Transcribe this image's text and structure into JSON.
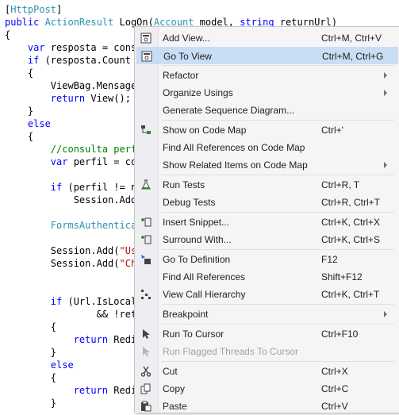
{
  "code_lines": [
    [
      {
        "t": "[",
        "c": "plain"
      },
      {
        "t": "HttpPost",
        "c": "type"
      },
      {
        "t": "]",
        "c": "plain"
      }
    ],
    [
      {
        "t": "public ",
        "c": "kw"
      },
      {
        "t": "ActionResult",
        "c": "type"
      },
      {
        "t": " LogOn(",
        "c": "plain"
      },
      {
        "t": "Account",
        "c": "type"
      },
      {
        "t": " model, ",
        "c": "plain"
      },
      {
        "t": "string",
        "c": "kw"
      },
      {
        "t": " returnUrl)",
        "c": "plain"
      }
    ],
    [
      {
        "t": "{",
        "c": "plain"
      }
    ],
    [
      {
        "t": "    ",
        "c": "plain"
      },
      {
        "t": "var",
        "c": "kw"
      },
      {
        "t": " resposta = cons",
        "c": "plain"
      }
    ],
    [
      {
        "t": "    ",
        "c": "plain"
      },
      {
        "t": "if",
        "c": "kw"
      },
      {
        "t": " (resposta.Count",
        "c": "plain"
      }
    ],
    [
      {
        "t": "    {",
        "c": "plain"
      }
    ],
    [
      {
        "t": "        ViewBag.Mensage",
        "c": "plain"
      }
    ],
    [
      {
        "t": "        ",
        "c": "plain"
      },
      {
        "t": "return",
        "c": "kw"
      },
      {
        "t": " View();",
        "c": "plain"
      }
    ],
    [
      {
        "t": "    }",
        "c": "plain"
      }
    ],
    [
      {
        "t": "    ",
        "c": "plain"
      },
      {
        "t": "else",
        "c": "kw"
      }
    ],
    [
      {
        "t": "    {",
        "c": "plain"
      }
    ],
    [
      {
        "t": "        //consulta perf",
        "c": "cm"
      }
    ],
    [
      {
        "t": "        ",
        "c": "plain"
      },
      {
        "t": "var",
        "c": "kw"
      },
      {
        "t": " perfil = co",
        "c": "plain"
      }
    ],
    [],
    [
      {
        "t": "        ",
        "c": "plain"
      },
      {
        "t": "if",
        "c": "kw"
      },
      {
        "t": " (perfil != n",
        "c": "plain"
      }
    ],
    [
      {
        "t": "            Session.Add",
        "c": "plain"
      }
    ],
    [],
    [
      {
        "t": "        ",
        "c": "plain"
      },
      {
        "t": "FormsAuthentica",
        "c": "type"
      }
    ],
    [],
    [
      {
        "t": "        Session.Add(",
        "c": "plain"
      },
      {
        "t": "\"Us",
        "c": "str"
      }
    ],
    [
      {
        "t": "        Session.Add(",
        "c": "plain"
      },
      {
        "t": "\"Ch",
        "c": "str"
      }
    ],
    [],
    [],
    [
      {
        "t": "        ",
        "c": "plain"
      },
      {
        "t": "if",
        "c": "kw"
      },
      {
        "t": " (Url.IsLocal",
        "c": "plain"
      }
    ],
    [
      {
        "t": "                && !ret",
        "c": "plain"
      }
    ],
    [
      {
        "t": "        {",
        "c": "plain"
      }
    ],
    [
      {
        "t": "            ",
        "c": "plain"
      },
      {
        "t": "return",
        "c": "kw"
      },
      {
        "t": " Redi",
        "c": "plain"
      }
    ],
    [
      {
        "t": "        }",
        "c": "plain"
      }
    ],
    [
      {
        "t": "        ",
        "c": "plain"
      },
      {
        "t": "else",
        "c": "kw"
      }
    ],
    [
      {
        "t": "        {",
        "c": "plain"
      }
    ],
    [
      {
        "t": "            ",
        "c": "plain"
      },
      {
        "t": "return",
        "c": "kw"
      },
      {
        "t": " Redi",
        "c": "plain"
      }
    ],
    [
      {
        "t": "        }",
        "c": "plain"
      }
    ]
  ],
  "context_menu": {
    "items": [
      {
        "type": "item",
        "id": "add-view",
        "label": "Add View...",
        "shortcut": "Ctrl+M, Ctrl+V",
        "icon": "add-view-icon"
      },
      {
        "type": "item",
        "id": "go-to-view",
        "label": "Go To View",
        "shortcut": "Ctrl+M, Ctrl+G",
        "icon": "go-to-view-icon",
        "hover": true
      },
      {
        "type": "sep"
      },
      {
        "type": "item",
        "id": "refactor",
        "label": "Refactor",
        "submenu": true
      },
      {
        "type": "item",
        "id": "organize-usings",
        "label": "Organize Usings",
        "submenu": true
      },
      {
        "type": "item",
        "id": "generate-sequence-diagram",
        "label": "Generate Sequence Diagram..."
      },
      {
        "type": "sep"
      },
      {
        "type": "item",
        "id": "show-on-code-map",
        "label": "Show on Code Map",
        "shortcut": "Ctrl+'",
        "icon": "code-map-icon"
      },
      {
        "type": "item",
        "id": "find-all-references-on-code-map",
        "label": "Find All References on Code Map"
      },
      {
        "type": "item",
        "id": "show-related-items-on-code-map",
        "label": "Show Related Items on Code Map",
        "submenu": true
      },
      {
        "type": "sep"
      },
      {
        "type": "item",
        "id": "run-tests",
        "label": "Run Tests",
        "shortcut": "Ctrl+R, T",
        "icon": "flask-icon"
      },
      {
        "type": "item",
        "id": "debug-tests",
        "label": "Debug Tests",
        "shortcut": "Ctrl+R, Ctrl+T"
      },
      {
        "type": "sep"
      },
      {
        "type": "item",
        "id": "insert-snippet",
        "label": "Insert Snippet...",
        "shortcut": "Ctrl+K, Ctrl+X",
        "icon": "insert-snippet-icon"
      },
      {
        "type": "item",
        "id": "surround-with",
        "label": "Surround With...",
        "shortcut": "Ctrl+K, Ctrl+S",
        "icon": "surround-with-icon"
      },
      {
        "type": "sep"
      },
      {
        "type": "item",
        "id": "go-to-definition",
        "label": "Go To Definition",
        "shortcut": "F12",
        "icon": "go-to-definition-icon"
      },
      {
        "type": "item",
        "id": "find-all-references",
        "label": "Find All References",
        "shortcut": "Shift+F12"
      },
      {
        "type": "item",
        "id": "view-call-hierarchy",
        "label": "View Call Hierarchy",
        "shortcut": "Ctrl+K, Ctrl+T",
        "icon": "call-hierarchy-icon"
      },
      {
        "type": "sep"
      },
      {
        "type": "item",
        "id": "breakpoint",
        "label": "Breakpoint",
        "submenu": true
      },
      {
        "type": "sep"
      },
      {
        "type": "item",
        "id": "run-to-cursor",
        "label": "Run To Cursor",
        "shortcut": "Ctrl+F10",
        "icon": "run-to-cursor-icon"
      },
      {
        "type": "item",
        "id": "run-flagged-threads-to-cursor",
        "label": "Run Flagged Threads To Cursor",
        "icon": "run-flagged-threads-icon",
        "disabled": true
      },
      {
        "type": "sep"
      },
      {
        "type": "item",
        "id": "cut",
        "label": "Cut",
        "shortcut": "Ctrl+X",
        "icon": "scissors-icon"
      },
      {
        "type": "item",
        "id": "copy",
        "label": "Copy",
        "shortcut": "Ctrl+C",
        "icon": "copy-icon"
      },
      {
        "type": "item",
        "id": "paste",
        "label": "Paste",
        "shortcut": "Ctrl+V",
        "icon": "paste-icon"
      }
    ]
  },
  "colors": {
    "keyword": "#0000ff",
    "type": "#2b91af",
    "string": "#a31515",
    "comment": "#008000",
    "menu_background": "#f5f5f5",
    "menu_gutter": "#eeeef2",
    "menu_hover": "#c9def5"
  }
}
